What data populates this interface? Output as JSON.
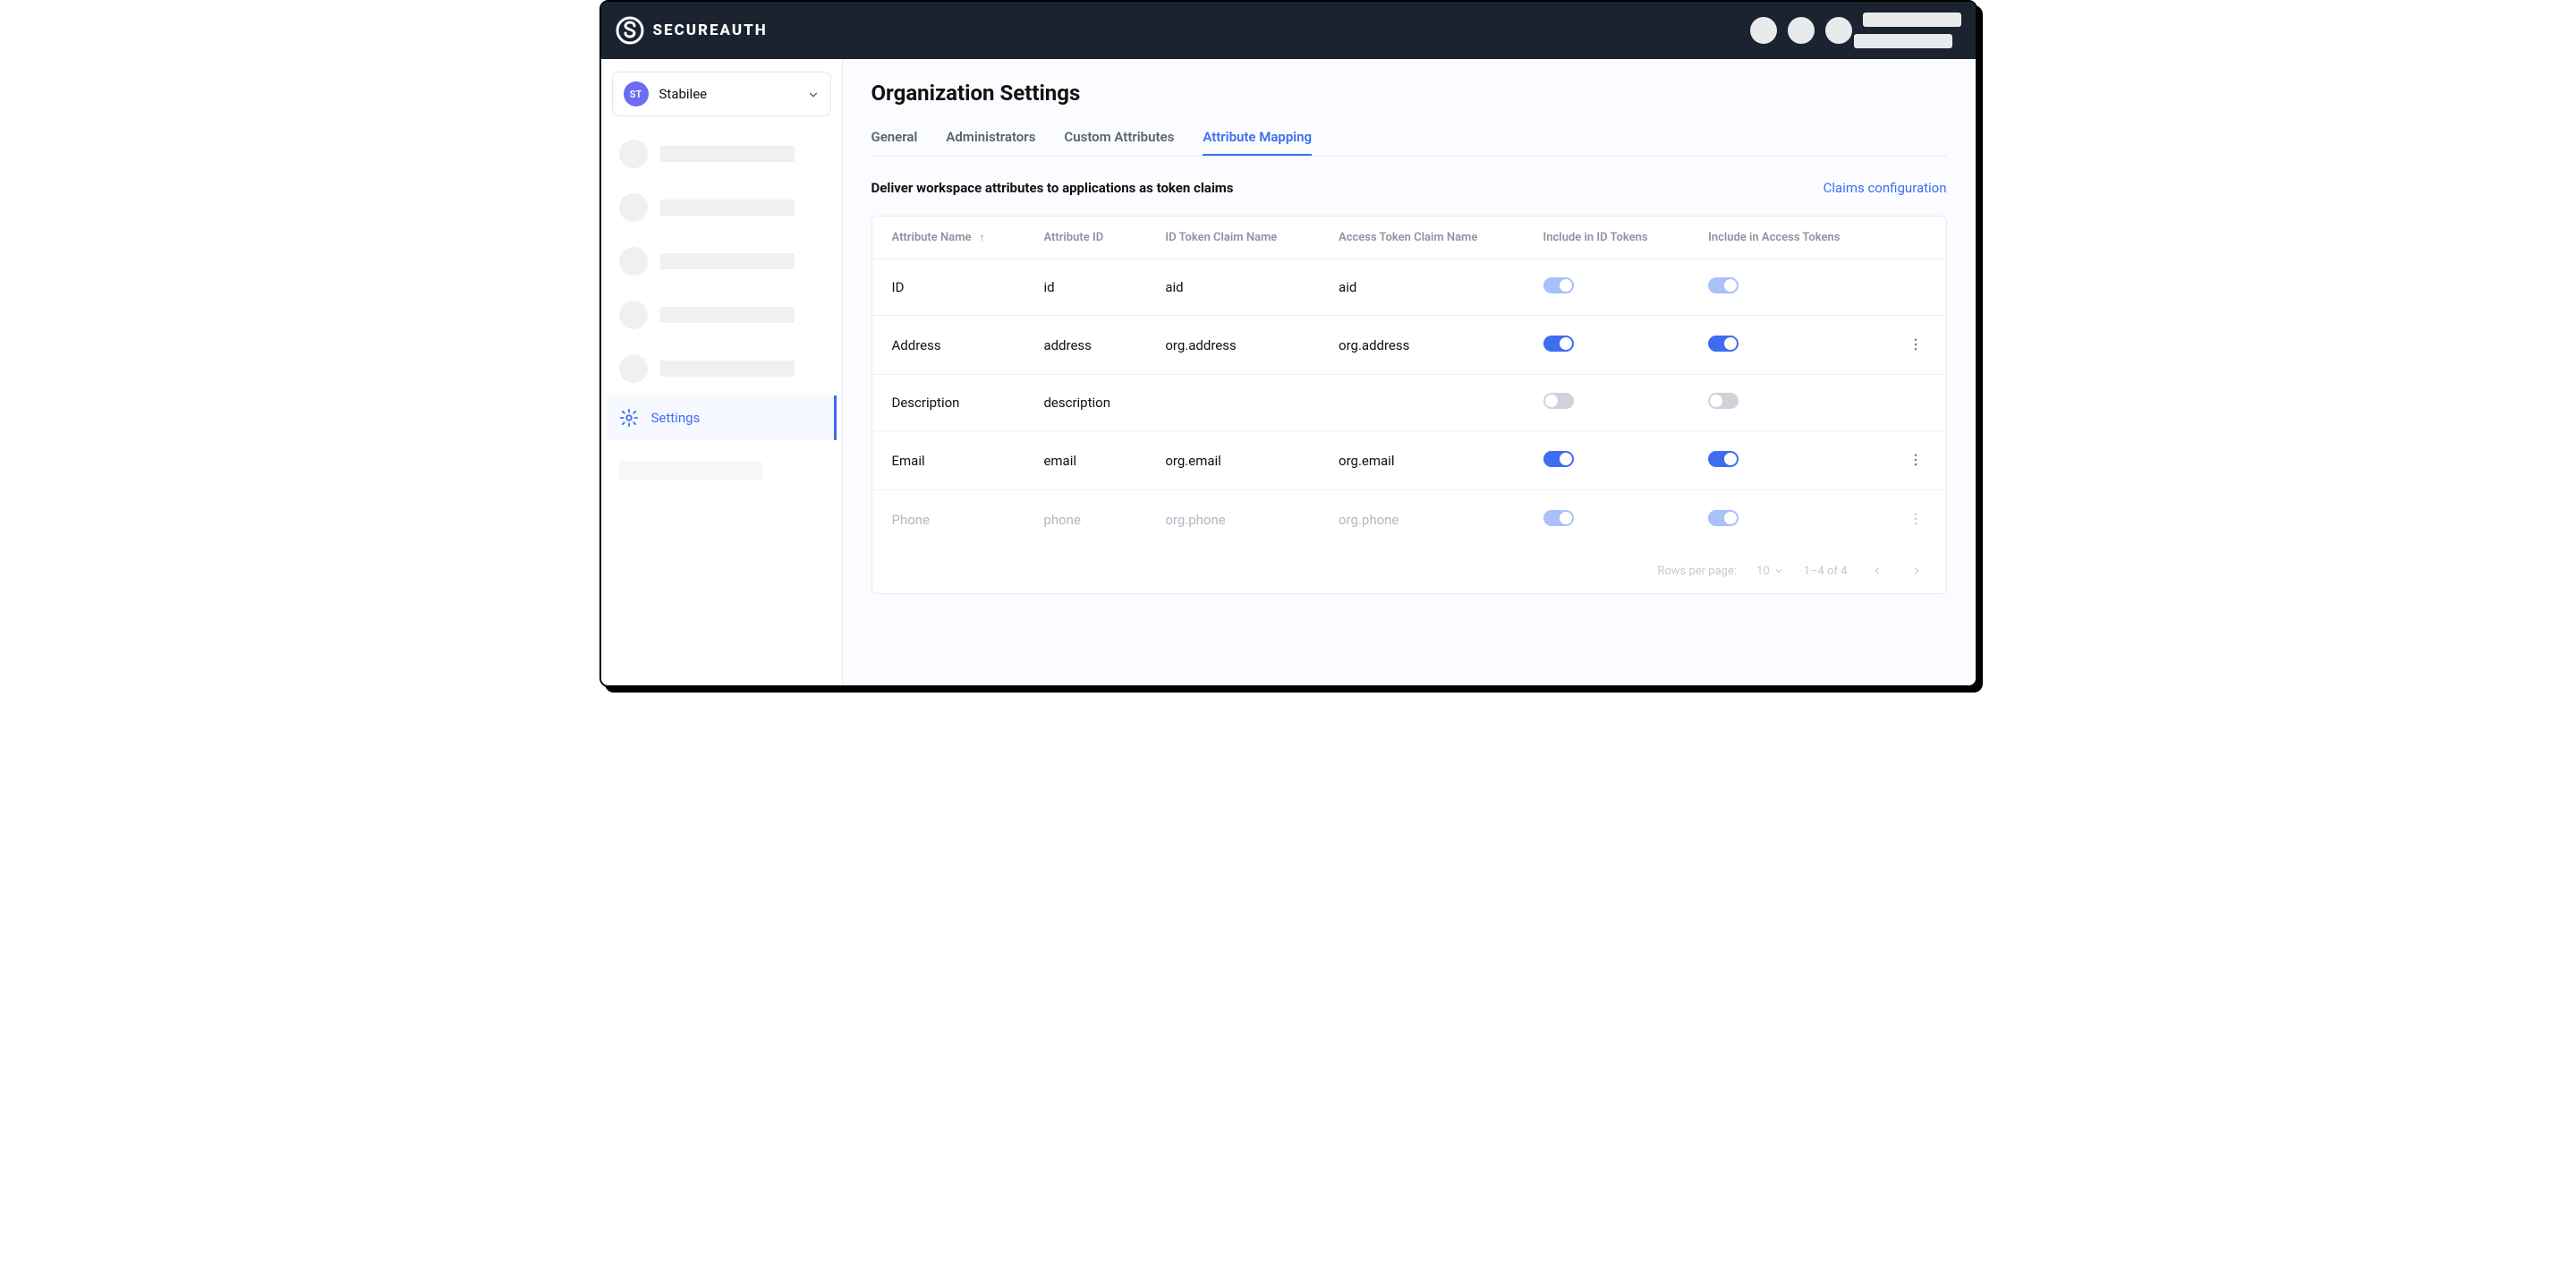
{
  "brand": {
    "name": "SECUREAUTH"
  },
  "org_switcher": {
    "initials": "ST",
    "name": "Stabilee"
  },
  "sidebar": {
    "settings_label": "Settings"
  },
  "page": {
    "title": "Organization Settings"
  },
  "tabs": [
    {
      "label": "General",
      "active": false
    },
    {
      "label": "Administrators",
      "active": false
    },
    {
      "label": "Custom Attributes",
      "active": false
    },
    {
      "label": "Attribute Mapping",
      "active": true
    }
  ],
  "section": {
    "title": "Deliver workspace attributes to applications as token claims",
    "claims_link": "Claims configuration"
  },
  "table": {
    "columns": {
      "attr_name": "Attribute Name",
      "attr_id": "Attribute ID",
      "id_claim": "ID Token Claim Name",
      "access_claim": "Access Token Claim Name",
      "include_id": "Include in ID Tokens",
      "include_access": "Include in Access Tokens"
    },
    "rows": [
      {
        "name": "ID",
        "id": "id",
        "id_claim": "aid",
        "access_claim": "aid",
        "include_id": "on_locked",
        "include_access": "on_locked",
        "has_menu": false,
        "faded": false
      },
      {
        "name": "Address",
        "id": "address",
        "id_claim": "org.address",
        "access_claim": "org.address",
        "include_id": "on",
        "include_access": "on",
        "has_menu": true,
        "faded": false
      },
      {
        "name": "Description",
        "id": "description",
        "id_claim": "",
        "access_claim": "",
        "include_id": "off",
        "include_access": "off",
        "has_menu": false,
        "faded": false
      },
      {
        "name": "Email",
        "id": "email",
        "id_claim": "org.email",
        "access_claim": "org.email",
        "include_id": "on",
        "include_access": "on",
        "has_menu": true,
        "faded": false
      },
      {
        "name": "Phone",
        "id": "phone",
        "id_claim": "org.phone",
        "access_claim": "org.phone",
        "include_id": "on_faded",
        "include_access": "on_faded",
        "has_menu": true,
        "faded": true
      }
    ],
    "footer": {
      "rows_per_page_label": "Rows per page:",
      "rows_per_page_value": "10",
      "range": "1–4 of 4"
    }
  }
}
